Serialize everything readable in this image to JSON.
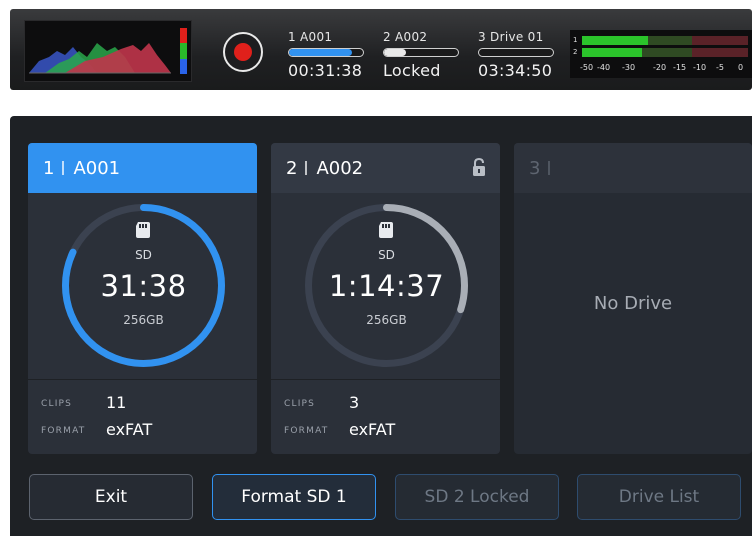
{
  "topbar": {
    "rgb_colors": [
      "#e0201b",
      "#2ab82a",
      "#2a63e8"
    ],
    "slots": [
      {
        "label": "1  A001",
        "value": "00:31:38",
        "fill_fraction": 0.85,
        "fill_color": "#3192f0"
      },
      {
        "label": "2  A002",
        "value": "Locked",
        "fill_fraction": 0.3,
        "fill_color": "#e9e9e9"
      },
      {
        "label": "3  Drive 01",
        "value": "03:34:50",
        "fill_fraction": 0.0,
        "fill_color": "#e9e9e9"
      }
    ],
    "meters": {
      "channels": [
        "1",
        "2"
      ],
      "scale": [
        "-50",
        "-40",
        "-30",
        "-20",
        "-15",
        "-10",
        "-5",
        "0"
      ]
    }
  },
  "cards": [
    {
      "number": "1",
      "name": "A001",
      "active": true,
      "locked": false,
      "media": "SD",
      "time": "31:38",
      "capacity": "256GB",
      "ring_fraction": 0.82,
      "ring_color": "#3192f0",
      "clips_label": "CLIPS",
      "clips": "11",
      "format_label": "FORMAT",
      "format": "exFAT"
    },
    {
      "number": "2",
      "name": "A002",
      "active": false,
      "locked": true,
      "media": "SD",
      "time": "1:14:37",
      "capacity": "256GB",
      "ring_fraction": 0.3,
      "ring_color": "#a9aeb6",
      "clips_label": "CLIPS",
      "clips": "3",
      "format_label": "FORMAT",
      "format": "exFAT"
    },
    {
      "number": "3",
      "name": "",
      "active": false,
      "empty": true,
      "empty_text": "No Drive"
    }
  ],
  "buttons": {
    "exit": "Exit",
    "format": "Format SD 1",
    "locked": "SD 2 Locked",
    "drive_list": "Drive List"
  }
}
